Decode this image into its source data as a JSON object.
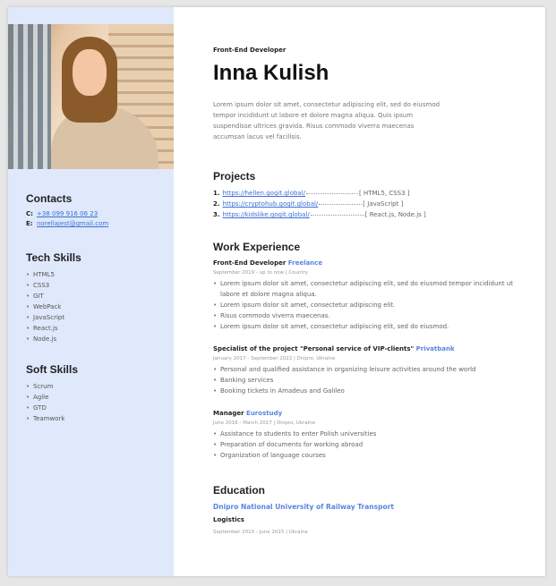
{
  "header": {
    "role": "Front-End Developer",
    "name": "Inna Kulish",
    "about": "Lorem ipsum dolor sit amet, consectetur adipiscing elit, sed do eiusmod tempor incididunt ut labore et dolore magna aliqua. Quis ipsum suspendisse ultrices gravida. Risus commodo viverra maecenas accumsan lacus vel facilisis."
  },
  "contacts": {
    "title": "Contacts",
    "phone_key": "C:",
    "phone": "+38 099 916 06 23",
    "email_key": "E:",
    "email": "norellajest@gmail.com"
  },
  "tech_skills": {
    "title": "Tech Skills",
    "items": [
      "HTML5",
      "CSS3",
      "GIT",
      "WebPack",
      "JavaScript",
      "React.js",
      "Node.js"
    ]
  },
  "soft_skills": {
    "title": "Soft Skills",
    "items": [
      "Scrum",
      "Agile",
      "GTD",
      "Teamwork"
    ]
  },
  "projects": {
    "title": "Projects",
    "items": [
      {
        "num": "1.",
        "link": "https://hellen.gogit.global/",
        "tech": "[ HTML5, CSS3 ]"
      },
      {
        "num": "2.",
        "link": "https://cryptohub.gogit.global/",
        "tech": "[ JavaScript ]"
      },
      {
        "num": "3.",
        "link": "https://kidslike.gogit.global/",
        "tech": "[ React.js, Node.js ]"
      }
    ]
  },
  "experience": {
    "title": "Work Experience",
    "jobs": [
      {
        "title": "Front-End Developer",
        "company": "Freelance",
        "meta": "September 2019 - up to now | Country",
        "items": [
          "Lorem ipsum dolor sit amet, consectetur adipiscing elit, sed do eiusmod tempor incididunt ut labore et dolore magna aliqua.",
          "Lorem ipsum dolor sit amet, consectetur adipiscing elit.",
          "Risus commodo viverra maecenas.",
          "Lorem ipsum dolor sit amet, consectetur adipiscing elit, sed do eiusmod."
        ]
      },
      {
        "title": "Specialist of the project \"Personal service of VIP-clients\"",
        "company": "Privatbank",
        "meta": "January 2017 - September 2022 | Dnipro, Ukraine",
        "items": [
          "Personal and qualified assistance in organizing leisure activities around the world",
          "Banking services",
          "Booking tickets in Amadeus and Galileo"
        ]
      },
      {
        "title": "Manager",
        "company": "Eurostudy",
        "meta": "June 2016 - March 2017 | Dnipro, Ukraine",
        "items": [
          "Assistance to students to enter Polish universities",
          "Preparation of documents for working abroad",
          "Organization of language courses"
        ]
      }
    ]
  },
  "education": {
    "title": "Education",
    "school": "Dnipro National University of Railway Transport",
    "degree": "Logistics",
    "meta": "September 2010 - June 2015 | Ukraine"
  }
}
